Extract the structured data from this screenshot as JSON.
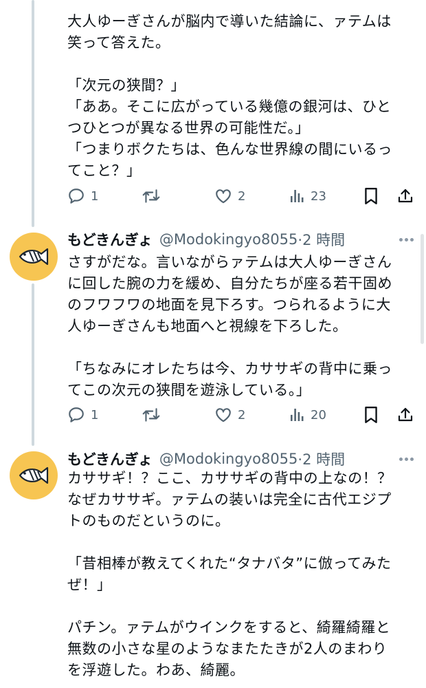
{
  "tweets": [
    {
      "text": [
        "大人ゆーぎさんが脳内で導いた結論に、ァテムは",
        "笑って答えた。",
        "",
        "「次元の狭間？」",
        "「ああ。そこに広がっている幾億の銀河は、ひと",
        "つひとつが異なる世界の可能性だ。」",
        "「つまりボクたちは、色んな世界線の間にいるっ",
        "てこと？」"
      ],
      "replies": "1",
      "likes": "2",
      "views": "23"
    },
    {
      "name": "もどきんぎょ",
      "handle": "@Modokingyo8055",
      "time": "·2 時間",
      "text": [
        "さすがだな。言いながらァテムは大人ゆーぎさん",
        "に回した腕の力を緩め、自分たちが座る若干固め",
        "のフワフワの地面を見下ろす。つられるように大",
        "人ゆーぎさんも地面へと視線を下ろした。",
        "",
        "「ちなみにオレたちは今、カササギの背中に乗っ",
        "てこの次元の狭間を遊泳している。」"
      ],
      "replies": "1",
      "likes": "2",
      "views": "20"
    },
    {
      "name": "もどきんぎょ",
      "handle": "@Modokingyo8055",
      "time": "·2 時間",
      "text": [
        "カササギ！？ここ、カササギの背中の上なの！？",
        "なぜカササギ。ァテムの装いは完全に古代エジプ",
        "トのものだというのに。",
        "",
        "「昔相棒が教えてくれた“タナバタ”に倣ってみた",
        "ぜ！」",
        "",
        "パチン。ァテムがウインクをすると、綺羅綺羅と",
        "無数の小さな星のようなまたたきが2人のまわり",
        "を浮遊した。わあ、綺麗。"
      ]
    }
  ],
  "icons": {
    "reply": "reply-icon",
    "retweet": "retweet-icon",
    "like": "heart-icon",
    "views": "views-icon",
    "bookmark": "bookmark-icon",
    "share": "share-icon",
    "more": "more-icon",
    "avatar": "fish-avatar-icon"
  },
  "colors": {
    "text": "#0f1419",
    "secondary": "#536471",
    "avatar_bg": "#f7c552",
    "thread_line": "#cfd9de"
  }
}
